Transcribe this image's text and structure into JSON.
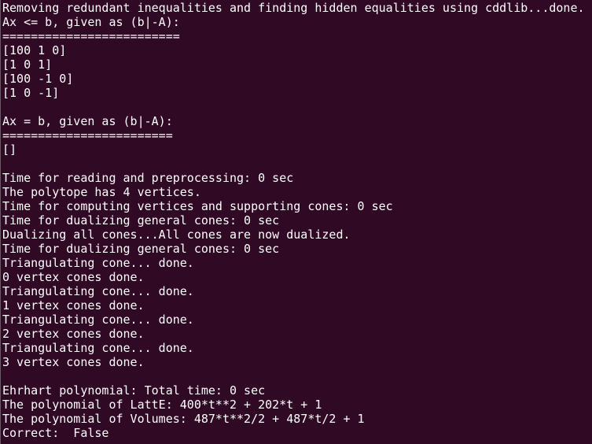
{
  "terminal": {
    "lines": [
      "Removing redundant inequalities and finding hidden equalities using cddlib...done.",
      "Ax <= b, given as (b|-A):",
      "=========================",
      "[100 1 0]",
      "[1 0 1]",
      "[100 -1 0]",
      "[1 0 -1]",
      "",
      "Ax = b, given as (b|-A):",
      "========================",
      "[]",
      "",
      "Time for reading and preprocessing: 0 sec",
      "The polytope has 4 vertices.",
      "Time for computing vertices and supporting cones: 0 sec",
      "Time for dualizing general cones: 0 sec",
      "Dualizing all cones...All cones are now dualized.",
      "Time for dualizing general cones: 0 sec",
      "Triangulating cone... done.",
      "0 vertex cones done.",
      "Triangulating cone... done.",
      "1 vertex cones done.",
      "Triangulating cone... done.",
      "2 vertex cones done.",
      "Triangulating cone... done.",
      "3 vertex cones done.",
      "",
      "Ehrhart polynomial: Total time: 0 sec",
      "The polynomial of LattE: 400*t**2 + 202*t + 1",
      "The polynomial of Volumes: 487*t**2/2 + 487*t/2 + 1",
      "Correct:  False"
    ]
  }
}
